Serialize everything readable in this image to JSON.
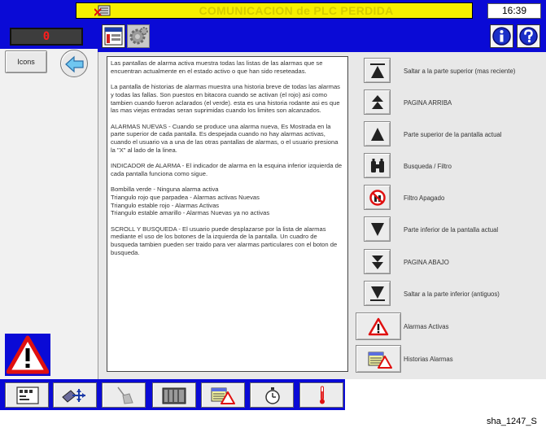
{
  "header": {
    "alarm_banner": "COMUNICACION de PLC PERDIDA",
    "clock": "16:39"
  },
  "left": {
    "alarm_counter": "0",
    "icons_button": "Icons"
  },
  "help_text": [
    "Las pantallas de alarma activa muestra todas las listas de las alarmas que se encuentran actualmente en el estado activo o que han sido reseteadas.",
    "La pantalla de historias de alarmas muestra una historia breve de todas las alarmas y todas las fallas. Son puestos en bitacora cuando se activan (el rojo) asi como tambien cuando fueron aclarados (el verde). esta es una historia rodante asi es que las mas viejas entradas seran suprimidas cuando los limites son alcanzados.",
    "ALARMAS NUEVAS - Cuando se produce una alarma nueva, Es Mostrada en la parte superior de cada pantalla. Es despejada cuando no hay alarmas activas, cuando el usuario va a una de las otras pantallas de alarmas, o el usuario presiona la \"X\" al lado de la linea.",
    "INDICADOR de ALARMA - El indicador de alarma en la esquina inferior izquierda de cada pantalla funciona como sigue.",
    "Bombilla verde - Ninguna alarma activa",
    "Triangulo rojo que parpadea - Alarmas activas Nuevas",
    "Triangulo estable rojo - Alarmas Activas",
    "Triangulo estable amarillo - Alarmas Nuevas ya no activas",
    "SCROLL Y BUSQUEDA - El usuario puede desplazarse por la lista de alarmas mediante el uso de los botones de la izquierda de la pantalla. Un cuadro de busqueda tambien pueden ser traido para ver alarmas particulares con el boton de busqueda."
  ],
  "side_buttons": [
    {
      "label": "Saltar a la parte superior (mas reciente)",
      "icon": "jump-top-icon"
    },
    {
      "label": "PAGINA ARRIBA",
      "icon": "page-up-icon"
    },
    {
      "label": "Parte superior de la pantalla actual",
      "icon": "screen-top-icon"
    },
    {
      "label": "Busqueda / Filtro",
      "icon": "binoculars-icon"
    },
    {
      "label": "Filtro Apagado",
      "icon": "filter-off-icon"
    },
    {
      "label": "Parte inferior de la pantalla actual",
      "icon": "screen-bottom-icon"
    },
    {
      "label": "PAGINA ABAJO",
      "icon": "page-down-icon"
    },
    {
      "label": "Saltar a la parte inferior (antiguos)",
      "icon": "jump-bottom-icon"
    }
  ],
  "wide_buttons": [
    {
      "label": "Alarmas Activas",
      "icon": "active-alarms-icon"
    },
    {
      "label": "Historias Alarmas",
      "icon": "alarm-history-icon"
    }
  ],
  "footer": {
    "image_id": "sha_1247_S"
  },
  "colors": {
    "frame_blue": "#0a0ad6",
    "banner_yellow": "#f6ef00",
    "alarm_red": "#e01010"
  }
}
